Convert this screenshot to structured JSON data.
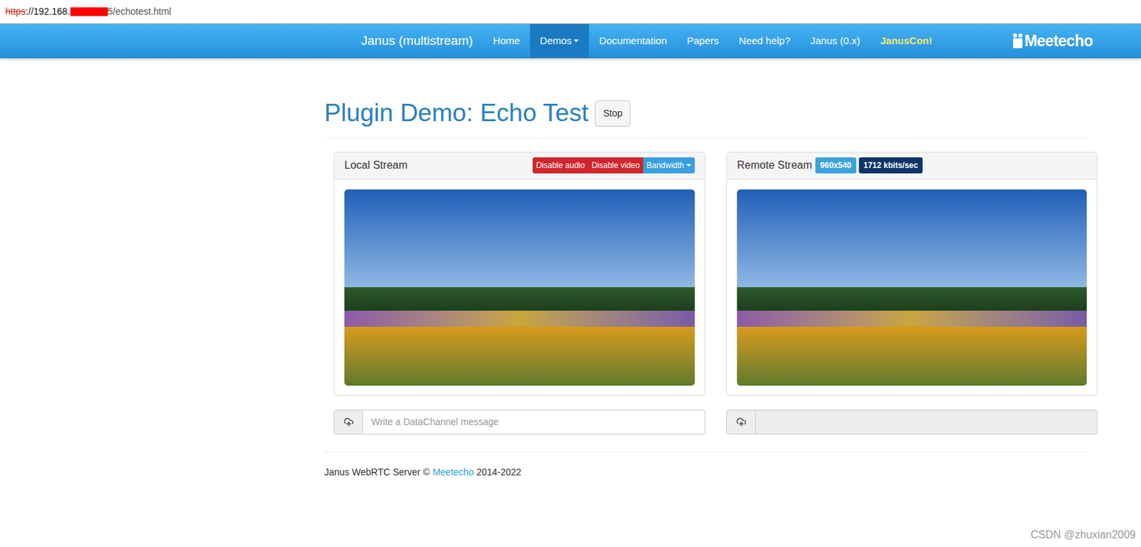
{
  "address_bar": {
    "scheme": "https",
    "scheme_insecure": true,
    "host_start": "://192.168.",
    "redacted": true,
    "host_end": "5/echotest.html"
  },
  "navbar": {
    "brand": "Janus (multistream)",
    "items": [
      {
        "label": "Home",
        "selected": false,
        "dropdown": false,
        "kind": "link"
      },
      {
        "label": "Demos",
        "selected": true,
        "dropdown": true,
        "kind": "link"
      },
      {
        "label": "Documentation",
        "selected": false,
        "dropdown": false,
        "kind": "link"
      },
      {
        "label": "Papers",
        "selected": false,
        "dropdown": false,
        "kind": "link"
      },
      {
        "label": "Need help?",
        "selected": false,
        "dropdown": false,
        "kind": "link"
      },
      {
        "label": "Janus (0.x)",
        "selected": false,
        "dropdown": false,
        "kind": "link"
      },
      {
        "label": "JanusCon!",
        "selected": false,
        "dropdown": false,
        "kind": "highlight"
      }
    ],
    "logo": "Meetecho"
  },
  "page": {
    "title": "Plugin Demo: Echo Test",
    "stop_button": "Stop"
  },
  "local_panel": {
    "title": "Local Stream",
    "buttons": [
      {
        "label": "Disable audio",
        "kind": "danger"
      },
      {
        "label": "Disable video",
        "kind": "danger"
      },
      {
        "label": "Bandwidth",
        "kind": "dropdown"
      }
    ],
    "datachannel": {
      "placeholder": "Write a DataChannel message",
      "value": "",
      "disabled": false
    }
  },
  "remote_panel": {
    "title": "Remote Stream",
    "badges": [
      {
        "label": "960x540",
        "color": "#3aa3dc"
      },
      {
        "label": "1712 kbits/sec",
        "color": "#0c3468"
      }
    ],
    "datachannel": {
      "placeholder": "",
      "value": "",
      "disabled": true
    }
  },
  "footer": {
    "text": "Janus WebRTC Server ©",
    "link": "Meetecho",
    "years": "2014-2022"
  },
  "watermark": "CSDN @zhuxian2009"
}
